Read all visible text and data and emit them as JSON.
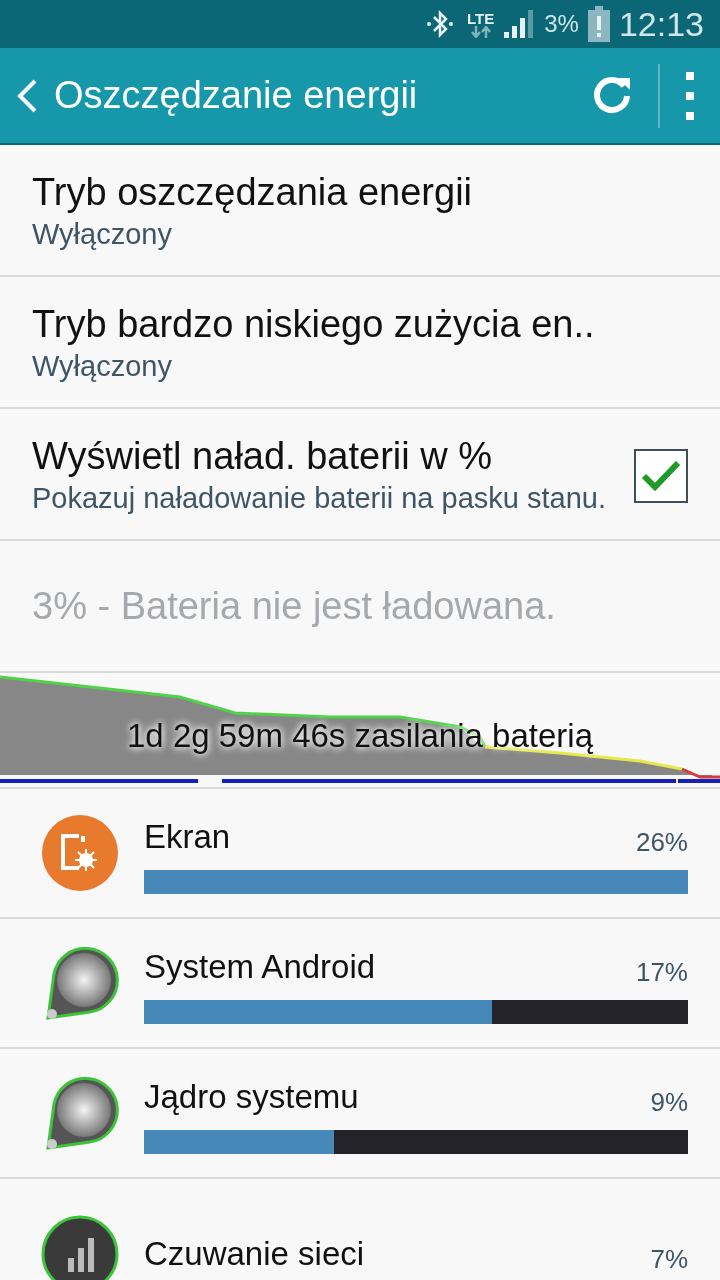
{
  "status_bar": {
    "network": "LTE",
    "battery": "3%",
    "time": "12:13"
  },
  "action_bar": {
    "title": "Oszczędzanie energii"
  },
  "settings": [
    {
      "title": "Tryb oszczędzania energii",
      "summary": "Wyłączony",
      "kind": "plain"
    },
    {
      "title": "Tryb bardzo niskiego zużycia en..",
      "summary": "Wyłączony",
      "kind": "plain"
    },
    {
      "title": "Wyświetl naład. baterii w %",
      "summary": "Pokazuj naładowanie baterii na pasku stanu.",
      "kind": "checkbox",
      "checked": true
    }
  ],
  "battery_status": "3% - Bateria nie jest ładowana.",
  "graph": {
    "label": "1d 2g 59m 46s zasilania baterią"
  },
  "usage": [
    {
      "name": "Ekran",
      "percent": "26%",
      "level": 1.0,
      "kind": "display"
    },
    {
      "name": "System Android",
      "percent": "17%",
      "level": 0.64,
      "kind": "dial"
    },
    {
      "name": "Jądro systemu",
      "percent": "9%",
      "level": 0.35,
      "kind": "dial"
    },
    {
      "name": "Czuwanie sieci",
      "percent": "7%",
      "kind": "signal"
    }
  ]
}
